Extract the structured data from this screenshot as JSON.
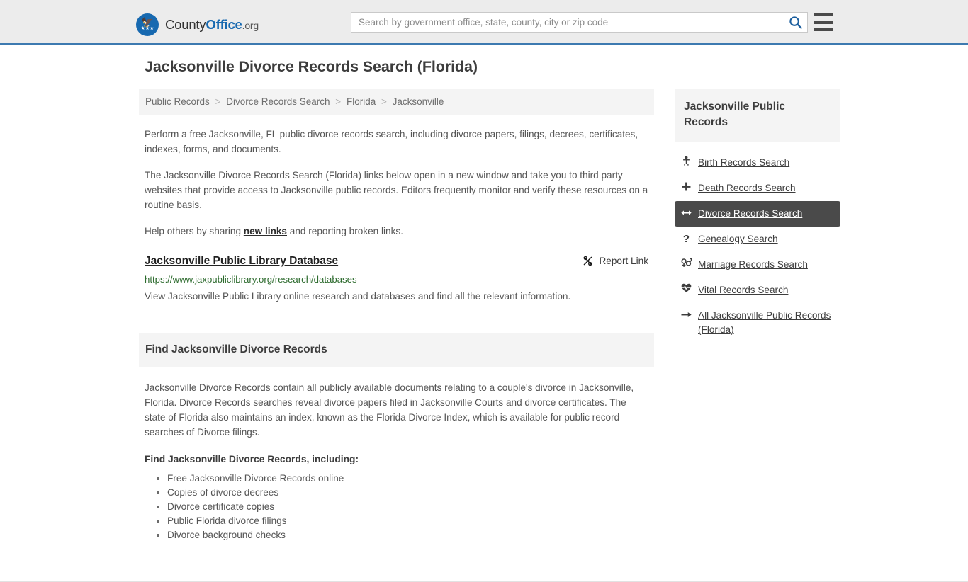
{
  "header": {
    "brand": {
      "county": "County",
      "office": "Office",
      "tld": ".org",
      "eagle_icon": "eagle-icon",
      "stars": "★★★"
    },
    "search": {
      "placeholder": "Search by government office, state, county, city or zip code",
      "value": ""
    },
    "search_icon": "search-icon",
    "menu_icon": "hamburger-menu-icon"
  },
  "page": {
    "title": "Jacksonville Divorce Records Search (Florida)"
  },
  "breadcrumb": {
    "items": [
      {
        "label": "Public Records"
      },
      {
        "label": "Divorce Records Search"
      },
      {
        "label": "Florida"
      },
      {
        "label": "Jacksonville"
      }
    ],
    "separator": ">"
  },
  "intro": {
    "p1": "Perform a free Jacksonville, FL public divorce records search, including divorce papers, filings, decrees, certificates, indexes, forms, and documents.",
    "p2": "The Jacksonville Divorce Records Search (Florida) links below open in a new window and take you to third party websites that provide access to Jacksonville public records. Editors frequently monitor and verify these resources on a routine basis.",
    "p3_before": "Help others by sharing ",
    "p3_link": "new links",
    "p3_after": " and reporting broken links."
  },
  "result": {
    "title": "Jacksonville Public Library Database",
    "url": "https://www.jaxpubliclibrary.org/research/databases",
    "description": "View Jacksonville Public Library online research and databases and find all the relevant information.",
    "report_label": "Report Link",
    "report_icon": "broken-link-icon"
  },
  "section": {
    "heading": "Find Jacksonville Divorce Records",
    "paragraph": "Jacksonville Divorce Records contain all publicly available documents relating to a couple's divorce in Jacksonville, Florida. Divorce Records searches reveal divorce papers filed in Jacksonville Courts and divorce certificates. The state of Florida also maintains an index, known as the Florida Divorce Index, which is available for public record searches of Divorce filings.",
    "subheading": "Find Jacksonville Divorce Records, including:",
    "bullets": [
      "Free Jacksonville Divorce Records online",
      "Copies of divorce decrees",
      "Divorce certificate copies",
      "Public Florida divorce filings",
      "Divorce background checks"
    ]
  },
  "sidebar": {
    "heading": "Jacksonville Public Records",
    "items": [
      {
        "label": "Birth Records Search",
        "icon": "baby-icon",
        "glyph": "Ɣ",
        "active": false
      },
      {
        "label": "Death Records Search",
        "icon": "cross-icon",
        "glyph": "✚",
        "active": false
      },
      {
        "label": "Divorce Records Search",
        "icon": "split-arrow-icon",
        "glyph": "↔",
        "active": true
      },
      {
        "label": "Genealogy Search",
        "icon": "question-icon",
        "glyph": "?",
        "active": false
      },
      {
        "label": "Marriage Records Search",
        "icon": "venus-mars-icon",
        "glyph": "⚥",
        "active": false
      },
      {
        "label": "Vital Records Search",
        "icon": "heartbeat-icon",
        "glyph": "♥",
        "active": false
      },
      {
        "label": "All Jacksonville Public Records (Florida)",
        "icon": "arrow-right-icon",
        "glyph": "→",
        "active": false
      }
    ]
  },
  "colors": {
    "brand_blue": "#1769b0",
    "header_bg": "#ececec",
    "header_border": "#3d7ab0",
    "panel_bg": "#f4f4f4",
    "active_bg": "#4a4a4a",
    "url_green": "#2d6b2e",
    "body_text": "#555555"
  }
}
